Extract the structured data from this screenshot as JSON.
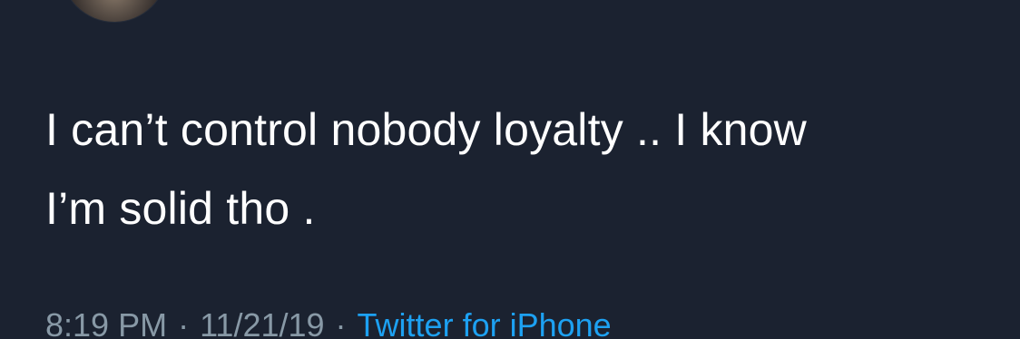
{
  "tweet": {
    "text_line1": "I can’t control nobody loyalty .. I know",
    "text_line2": "I’m solid tho ."
  },
  "meta": {
    "time": "8:19 PM",
    "separator": "·",
    "date": "11/21/19",
    "source": "Twitter for iPhone"
  },
  "colors": {
    "background": "#1b2230",
    "text": "#ffffff",
    "muted": "#8899a6",
    "link": "#1da1f2"
  }
}
